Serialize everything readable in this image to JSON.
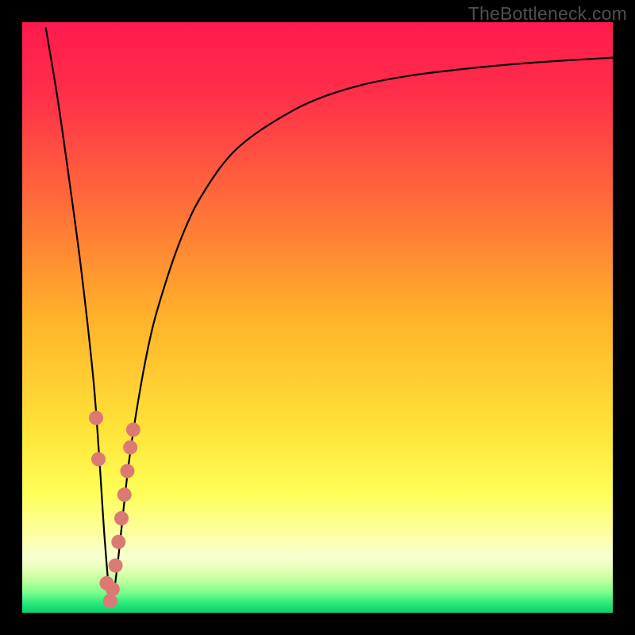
{
  "watermark": "TheBottleneck.com",
  "colors": {
    "frame": "#000000",
    "curve": "#000000",
    "marker": "#db7a74",
    "gradient_stops": [
      {
        "offset": 0.0,
        "color": "#ff1a4e"
      },
      {
        "offset": 0.12,
        "color": "#ff2e4a"
      },
      {
        "offset": 0.3,
        "color": "#ff6a3a"
      },
      {
        "offset": 0.5,
        "color": "#ffb22a"
      },
      {
        "offset": 0.7,
        "color": "#ffe63a"
      },
      {
        "offset": 0.8,
        "color": "#ffff5a"
      },
      {
        "offset": 0.86,
        "color": "#fdff9a"
      },
      {
        "offset": 0.905,
        "color": "#f8ffd0"
      },
      {
        "offset": 0.925,
        "color": "#e6ffb8"
      },
      {
        "offset": 0.945,
        "color": "#c0ff9e"
      },
      {
        "offset": 0.965,
        "color": "#7dff8c"
      },
      {
        "offset": 0.985,
        "color": "#25e77a"
      },
      {
        "offset": 1.0,
        "color": "#0fce6d"
      }
    ]
  },
  "chart_data": {
    "type": "line",
    "title": "",
    "xlabel": "",
    "ylabel": "",
    "xlim": [
      0,
      100
    ],
    "ylim": [
      0,
      100
    ],
    "series": [
      {
        "name": "bottleneck-curve",
        "x": [
          4,
          6,
          8,
          10,
          12,
          13,
          14,
          15,
          16,
          18,
          20,
          22,
          24,
          26,
          28,
          30,
          34,
          38,
          44,
          50,
          58,
          66,
          74,
          82,
          90,
          100
        ],
        "y": [
          99,
          87,
          73,
          58,
          40,
          27,
          12,
          2,
          7,
          25,
          38,
          48,
          55,
          61,
          66,
          70,
          76,
          80,
          84,
          87,
          89.5,
          91,
          92,
          92.8,
          93.4,
          94
        ]
      }
    ],
    "markers": {
      "name": "highlighted-points",
      "x": [
        12.5,
        12.9,
        14.3,
        14.9,
        15.3,
        15.8,
        16.3,
        16.8,
        17.3,
        17.8,
        18.3,
        18.8
      ],
      "y": [
        33,
        26,
        5,
        2,
        4,
        8,
        12,
        16,
        20,
        24,
        28,
        31
      ]
    }
  }
}
